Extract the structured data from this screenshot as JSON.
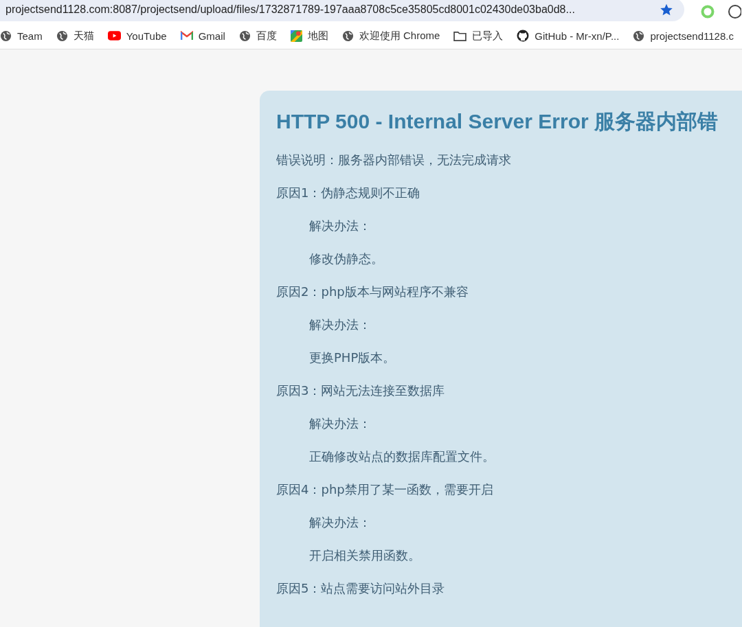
{
  "browser": {
    "address": "projectsend1128.com:8087/projectsend/upload/files/1732871789-197aaa8708c5ce35805cd8001c02430de03ba0d8...",
    "bookmarked": true
  },
  "bookmarks": [
    {
      "label": "Team",
      "kind": "globe"
    },
    {
      "label": "天猫",
      "kind": "globe"
    },
    {
      "label": "YouTube",
      "kind": "youtube"
    },
    {
      "label": "Gmail",
      "kind": "gmail"
    },
    {
      "label": "百度",
      "kind": "globe"
    },
    {
      "label": "地图",
      "kind": "maps"
    },
    {
      "label": "欢迎使用 Chrome",
      "kind": "globe"
    },
    {
      "label": "已导入",
      "kind": "folder"
    },
    {
      "label": "GitHub - Mr-xn/P...",
      "kind": "github"
    },
    {
      "label": "projectsend1128.c",
      "kind": "globe"
    }
  ],
  "error": {
    "title": "HTTP 500 - Internal Server Error 服务器内部错",
    "description": "错误说明：服务器内部错误，无法完成请求",
    "causes": [
      {
        "reason": "原因1：伪静态规则不正确",
        "solution_label": "解决办法：",
        "solution": "修改伪静态。"
      },
      {
        "reason": "原因2：php版本与网站程序不兼容",
        "solution_label": "解决办法：",
        "solution": "更换PHP版本。"
      },
      {
        "reason": "原因3：网站无法连接至数据库",
        "solution_label": "解决办法：",
        "solution": "正确修改站点的数据库配置文件。"
      },
      {
        "reason": "原因4：php禁用了某一函数，需要开启",
        "solution_label": "解决办法：",
        "solution": "开启相关禁用函数。"
      },
      {
        "reason": "原因5：站点需要访问站外目录"
      }
    ]
  }
}
